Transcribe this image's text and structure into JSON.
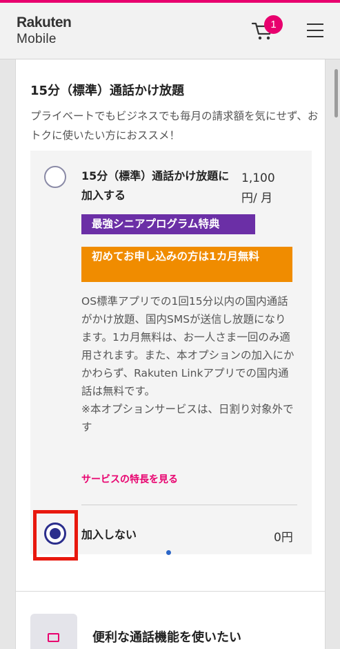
{
  "header": {
    "logo_line1": "Rakuten",
    "logo_line2": "Mobile",
    "cart_count": "1",
    "cart_icon": "cart-icon",
    "menu_icon": "hamburger-menu-icon"
  },
  "section": {
    "title": "15分（標準）通話かけ放題",
    "description": "プライベートでもビジネスでも毎月の請求額を気にせず、おトクに使いたい方におススメ！"
  },
  "option_subscribe": {
    "name": "15分（標準）通話かけ放題に加入する",
    "price": "1,100円/ 月",
    "badge_senior": "最強シニアプログラム特典",
    "badge_first_month": "初めてお申し込みの方は1カ月無料",
    "body_text": "OS標準アプリでの1回15分以内の国内通話がかけ放題、国内SMSが送信し放題になります。1カ月無料は、お一人さま一回のみ適用されます。また、本オプションの加入にかかわらず、Rakuten Linkアプリでの国内通話は無料です。",
    "note": "※本オプションサービスは、日割り対象外です",
    "features_link": "サービスの特長を見る",
    "selected": false
  },
  "option_decline": {
    "name": "加入しない",
    "price": "0円",
    "selected": true
  },
  "next_section": {
    "title": "便利な通話機能を使いたい",
    "icon": "video-icon"
  },
  "colors": {
    "brand_pink": "#e8006e",
    "radio_blue": "#2b2e8c",
    "badge_purple": "#6b2fa6",
    "badge_orange": "#f08c00",
    "highlight_red": "#e8180e"
  }
}
